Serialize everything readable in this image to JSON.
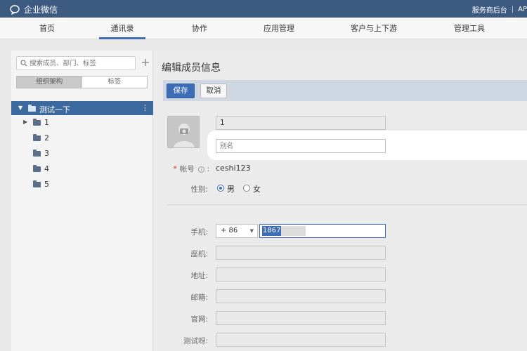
{
  "app": {
    "title": "企业微信",
    "top_links": [
      "服务商后台",
      "|",
      "AP"
    ]
  },
  "nav": {
    "tabs": [
      {
        "label": "首页",
        "active": false
      },
      {
        "label": "通讯录",
        "active": true
      },
      {
        "label": "协作",
        "active": false
      },
      {
        "label": "应用管理",
        "active": false
      },
      {
        "label": "客户与上下游",
        "active": false
      },
      {
        "label": "管理工具",
        "active": false
      }
    ]
  },
  "sidebar": {
    "search_placeholder": "搜索成员、部门、标签",
    "add_label": "+",
    "segments": [
      {
        "label": "组织架构",
        "active": true
      },
      {
        "label": "标签",
        "active": false
      }
    ],
    "root": {
      "label": "测试一下",
      "more": "⋮"
    },
    "departments": [
      {
        "label": "1",
        "expandable": true
      },
      {
        "label": "2",
        "expandable": false
      },
      {
        "label": "3",
        "expandable": false
      },
      {
        "label": "4",
        "expandable": false
      },
      {
        "label": "5",
        "expandable": false
      }
    ]
  },
  "form": {
    "title": "编辑成员信息",
    "save_label": "保存",
    "cancel_label": "取消",
    "name_value": "1",
    "alias_placeholder": "别名",
    "account_label": "帐号",
    "account_required": "*",
    "account_info_icon": "i",
    "account_colon": ":",
    "account_value": "ceshi123",
    "gender_label": "性别:",
    "gender_options": [
      {
        "label": "男",
        "checked": true
      },
      {
        "label": "女",
        "checked": false
      }
    ],
    "mobile_label": "手机:",
    "country_code": "+ 86",
    "mobile_value": "1867",
    "landline_label": "座机:",
    "address_label": "地址:",
    "email_label": "邮箱:",
    "website_label": "官网:",
    "custom_label": "测试呀:"
  },
  "colors": {
    "topbar": "#3d5a80",
    "accent": "#3d6db5",
    "tree_selected": "#3d6a9e"
  }
}
